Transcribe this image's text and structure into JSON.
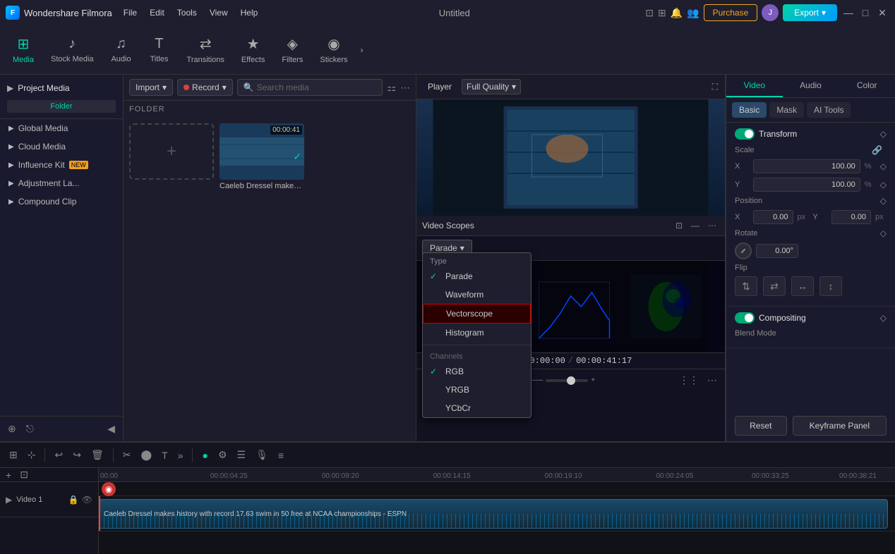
{
  "app": {
    "name": "Wondershare Filmora",
    "title": "Untitled",
    "logo_letter": "F"
  },
  "titlebar": {
    "menu": [
      "File",
      "Edit",
      "Tools",
      "View",
      "Help"
    ],
    "purchase_label": "Purchase",
    "export_label": "Export",
    "user_initial": "J",
    "min_label": "—",
    "max_label": "□",
    "close_label": "✕"
  },
  "toolbar": {
    "items": [
      {
        "id": "media",
        "icon": "⊞",
        "label": "Media",
        "active": true
      },
      {
        "id": "stock-media",
        "icon": "♪",
        "label": "Stock Media"
      },
      {
        "id": "audio",
        "icon": "♫",
        "label": "Audio"
      },
      {
        "id": "titles",
        "icon": "T",
        "label": "Titles"
      },
      {
        "id": "transitions",
        "icon": "⇄",
        "label": "Transitions"
      },
      {
        "id": "effects",
        "icon": "★",
        "label": "Effects"
      },
      {
        "id": "filters",
        "icon": "◈",
        "label": "Filters"
      },
      {
        "id": "stickers",
        "icon": "◉",
        "label": "Stickers"
      }
    ],
    "more_label": "›"
  },
  "sidebar": {
    "project_media_label": "Project Media",
    "folder_label": "Folder",
    "items": [
      {
        "label": "Global Media",
        "has_arrow": true
      },
      {
        "label": "Cloud Media",
        "has_arrow": true
      },
      {
        "label": "Influence Kit",
        "has_arrow": true,
        "badge": "NEW"
      },
      {
        "label": "Adjustment La...",
        "has_arrow": true
      },
      {
        "label": "Compound Clip",
        "has_arrow": true
      }
    ]
  },
  "media_panel": {
    "import_label": "Import",
    "record_label": "Record",
    "search_placeholder": "Search media",
    "folder_label": "FOLDER",
    "media_items": [
      {
        "duration": "00:00:41",
        "label": "Caeleb Dressel makes ...",
        "has_check": true
      }
    ]
  },
  "player": {
    "tab_label": "Player",
    "quality_label": "Full Quality",
    "timecode_current": "00:00:00:00",
    "timecode_total": "00:00:41:17"
  },
  "video_scopes": {
    "title": "Video Scopes",
    "dropdown_label": "Parade",
    "type_section": "Type",
    "types": [
      {
        "label": "Parade",
        "checked": true
      },
      {
        "label": "Waveform",
        "checked": false
      },
      {
        "label": "Vectorscope",
        "checked": false,
        "highlighted": true
      },
      {
        "label": "Histogram",
        "checked": false
      }
    ],
    "channels_section": "Channels",
    "channels": [
      {
        "label": "RGB",
        "checked": true
      },
      {
        "label": "YRGB",
        "checked": false
      },
      {
        "label": "YCbCr",
        "checked": false
      }
    ]
  },
  "properties": {
    "tabs": [
      "Video",
      "Audio",
      "Color"
    ],
    "active_tab": "Video",
    "subtabs": [
      "Basic",
      "Mask",
      "AI Tools"
    ],
    "active_subtab": "Basic",
    "transform": {
      "section_label": "Transform",
      "scale_label": "Scale",
      "scale_x_label": "X",
      "scale_x_value": "100.00",
      "scale_y_label": "Y",
      "scale_y_value": "100.00",
      "percent_label": "%",
      "position_label": "Position",
      "pos_x_label": "X",
      "pos_x_value": "0.00",
      "pos_x_unit": "px",
      "pos_y_label": "Y",
      "pos_y_value": "0.00",
      "pos_y_unit": "px",
      "rotate_label": "Rotate",
      "rotate_value": "0.00°",
      "flip_label": "Flip"
    },
    "compositing": {
      "section_label": "Compositing",
      "blend_mode_label": "Blend Mode"
    },
    "reset_label": "Reset",
    "keyframe_panel_label": "Keyframe Panel"
  },
  "timeline": {
    "toolbar_buttons": [
      "⊞",
      "⊹",
      "↩",
      "↪",
      "🗑",
      "✂",
      "⬤",
      "T",
      "»",
      "●",
      "⚙",
      "☰",
      "🎙",
      "≡"
    ],
    "tracks": [
      {
        "label": "Video 1",
        "icons": [
          "⬤",
          "🔒",
          "👁"
        ]
      }
    ],
    "ruler_ticks": [
      "00:00",
      "00:00:04:25",
      "00:00:09:20",
      "00:00:14:15",
      "00:00:19:10",
      "00:00:24:05",
      "00:00:33:25",
      "00:00:38:21"
    ],
    "clip_label": "Caeleb Dressel makes history with record 17.63 swim in 50 free at NCAA championships - ESPN"
  }
}
